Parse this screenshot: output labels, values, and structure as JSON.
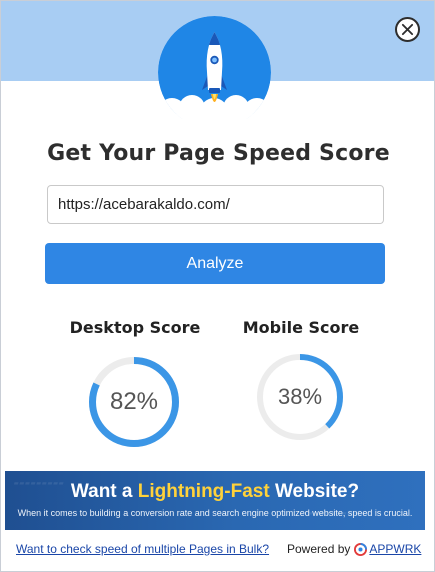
{
  "header": {
    "close_icon": "close-icon",
    "logo_icon": "rocket-icon"
  },
  "main": {
    "title": "Get Your Page Speed Score",
    "url_value": "https://acebarakaldo.com/",
    "analyze_label": "Analyze"
  },
  "scores": {
    "desktop": {
      "label": "Desktop Score",
      "value": 82,
      "display": "82%"
    },
    "mobile": {
      "label": "Mobile Score",
      "value": 38,
      "display": "38%"
    }
  },
  "banner": {
    "title_prefix": "Want a ",
    "title_highlight": "Lightning-Fast",
    "title_suffix": " Website?",
    "subtitle": "When it comes to building a conversion rate and search engine optimized website, speed is crucial."
  },
  "footer": {
    "bulk_link": "Want to check speed of multiple Pages in Bulk?",
    "powered_by": "Powered by",
    "brand": "APPWRK"
  },
  "colors": {
    "top_band": "#a8cdf3",
    "primary": "#2f86e4",
    "gauge_fill": "#3b96e6",
    "gauge_track": "#ececec",
    "highlight": "#ffd23a"
  }
}
